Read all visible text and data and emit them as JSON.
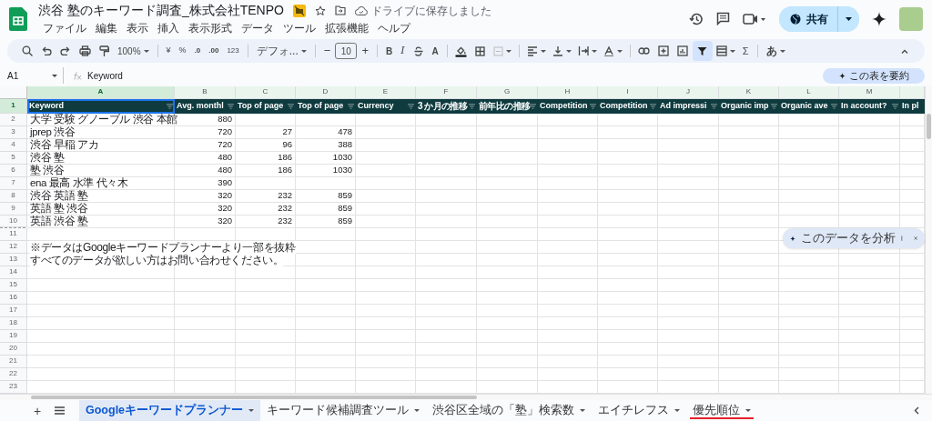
{
  "document": {
    "title": "渋谷 塾のキーワード調査_株式会社TENPO",
    "save_status": "ドライブに保存しました"
  },
  "menu": [
    "ファイル",
    "編集",
    "表示",
    "挿入",
    "表示形式",
    "データ",
    "ツール",
    "拡張機能",
    "ヘルプ"
  ],
  "share_button": "共有",
  "toolbar": {
    "decrease_font": "−",
    "increase_font": "+",
    "functions": "Σ",
    "zoom": "100%",
    "currency": "¥",
    "percent": "%",
    "decrease_decimal": ".0",
    "increase_decimal": ".00",
    "number_format": "123",
    "font": "デフォ...",
    "font_size": "10",
    "bold": "B",
    "italic": "I",
    "text_color": "A",
    "input_tool": "あ",
    "filter_on": true
  },
  "formula_bar": {
    "cell": "A1",
    "formula": "Keyword"
  },
  "summary_button": "この表を要約",
  "columns": [
    {
      "letter": "A",
      "selected": true
    },
    {
      "letter": "B",
      "selected": false
    },
    {
      "letter": "C",
      "selected": false
    },
    {
      "letter": "D",
      "selected": false
    },
    {
      "letter": "E",
      "selected": false
    },
    {
      "letter": "F",
      "selected": false
    },
    {
      "letter": "G",
      "selected": false
    },
    {
      "letter": "H",
      "selected": false
    },
    {
      "letter": "I",
      "selected": false
    },
    {
      "letter": "J",
      "selected": false
    },
    {
      "letter": "K",
      "selected": false
    },
    {
      "letter": "L",
      "selected": false
    },
    {
      "letter": "M",
      "selected": false
    }
  ],
  "header_row": {
    "number": "1",
    "selected": true,
    "cells": [
      "Keyword",
      "Avg. monthl",
      "Top of page",
      "Top of page",
      "Currency",
      "3 か月の推移",
      "前年比の推移",
      "Competition",
      "Competition",
      "Ad impressi",
      "Organic imp",
      "Organic ave",
      "In account?",
      "In pl"
    ]
  },
  "rows": [
    {
      "number": "2",
      "selected": false,
      "keyword": "大学 受験 グノーブル 渋谷 本館",
      "avg": "880"
    },
    {
      "number": "3",
      "selected": false,
      "keyword": "jprep 渋谷",
      "avg": "720",
      "top_low": "27",
      "top_high": "478"
    },
    {
      "number": "4",
      "selected": false,
      "keyword": "渋谷 早稲 アカ",
      "avg": "720",
      "top_low": "96",
      "top_high": "388"
    },
    {
      "number": "5",
      "selected": false,
      "keyword": "渋谷 塾",
      "avg": "480",
      "top_low": "186",
      "top_high": "1030"
    },
    {
      "number": "6",
      "selected": false,
      "keyword": "塾 渋谷",
      "avg": "480",
      "top_low": "186",
      "top_high": "1030"
    },
    {
      "number": "7",
      "selected": false,
      "keyword": "ena 最高 水準 代々木",
      "avg": "390"
    },
    {
      "number": "8",
      "selected": false,
      "keyword": "渋谷 英語 塾",
      "avg": "320",
      "top_low": "232",
      "top_high": "859"
    },
    {
      "number": "9",
      "selected": false,
      "keyword": "英語 塾 渋谷",
      "avg": "320",
      "top_low": "232",
      "top_high": "859"
    },
    {
      "number": "10",
      "selected": false,
      "keyword": "英語 渋谷 塾",
      "avg": "320",
      "top_low": "232",
      "top_high": "859"
    },
    {
      "number": "11",
      "selected": false
    },
    {
      "number": "12",
      "selected": false,
      "note": "※データはGoogleキーワードプランナーより一部を抜粋"
    },
    {
      "number": "13",
      "selected": false,
      "note": "すべてのデータが欲しい方はお問い合わせください。"
    },
    {
      "number": "14",
      "selected": false
    },
    {
      "number": "15",
      "selected": false
    },
    {
      "number": "16",
      "selected": false
    },
    {
      "number": "17",
      "selected": false
    },
    {
      "number": "18",
      "selected": false
    },
    {
      "number": "19",
      "selected": false
    },
    {
      "number": "20",
      "selected": false
    },
    {
      "number": "21",
      "selected": false
    },
    {
      "number": "22",
      "selected": false
    },
    {
      "number": "23",
      "selected": false
    }
  ],
  "analyze_chip": "このデータを分析",
  "add_sheet_button": "+",
  "sheet_tabs": [
    {
      "label": "Googleキーワードプランナー",
      "selected": true
    },
    {
      "label": "キーワード候補調査ツール",
      "selected": false
    },
    {
      "label": "渋谷区全域の「塾」検索数",
      "selected": false
    },
    {
      "label": "エイチレフス",
      "selected": false
    },
    {
      "label": "優先順位",
      "selected": false,
      "color": "#e8222a"
    }
  ]
}
